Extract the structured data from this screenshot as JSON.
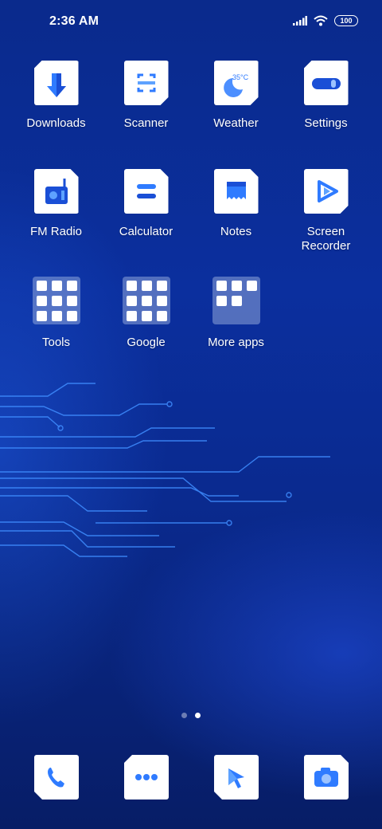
{
  "status_bar": {
    "time": "2:36 AM",
    "battery": "100"
  },
  "apps": [
    {
      "label": "Downloads"
    },
    {
      "label": "Scanner"
    },
    {
      "label": "Weather",
      "temp": "35°C"
    },
    {
      "label": "Settings"
    },
    {
      "label": "FM Radio"
    },
    {
      "label": "Calculator"
    },
    {
      "label": "Notes"
    },
    {
      "label": "Screen\nRecorder"
    }
  ],
  "folders": [
    {
      "label": "Tools"
    },
    {
      "label": "Google"
    },
    {
      "label": "More apps"
    }
  ],
  "page_indicator": {
    "current": 2,
    "total": 2
  },
  "dock": [
    {
      "name": "phone-icon"
    },
    {
      "name": "messages-icon"
    },
    {
      "name": "browser-icon"
    },
    {
      "name": "camera-icon"
    }
  ],
  "colors": {
    "accent": "#2f7bff",
    "accent_dark": "#1a4fd6",
    "tile": "#ffffff"
  }
}
